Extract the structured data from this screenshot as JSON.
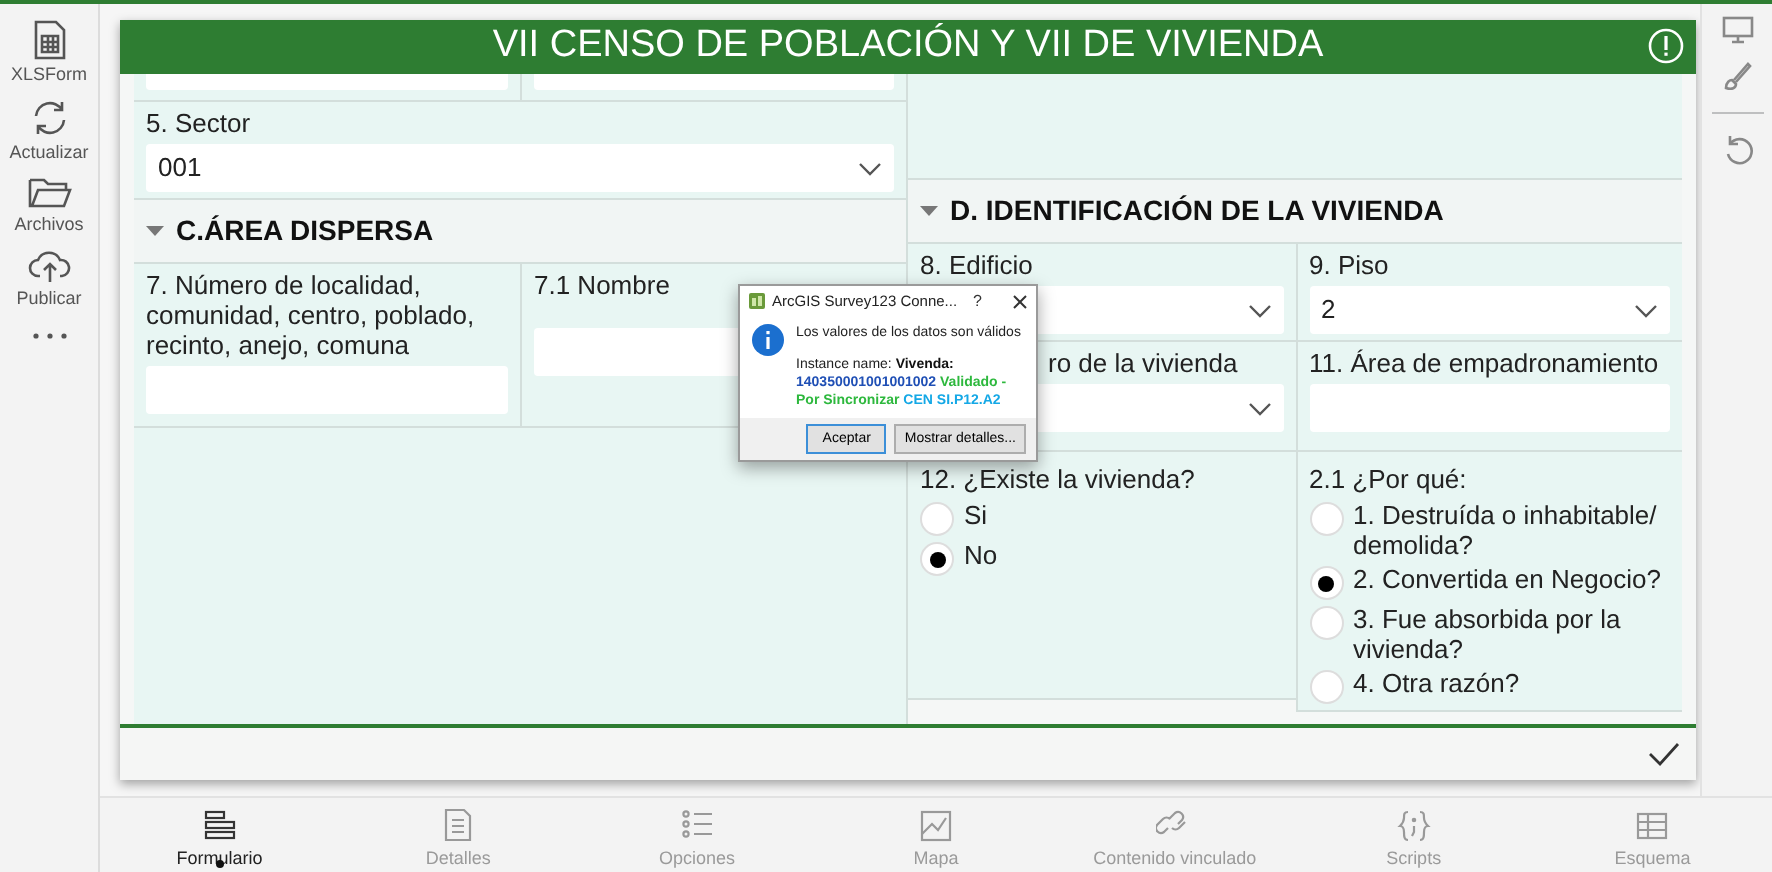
{
  "sidebar": {
    "items": [
      {
        "label": "XLSForm"
      },
      {
        "label": "Actualizar"
      },
      {
        "label": "Archivos"
      },
      {
        "label": "Publicar"
      }
    ]
  },
  "form": {
    "title": "VII CENSO DE POBLACIÓN Y VII DE VIVIENDA",
    "sector": {
      "label": "5. Sector",
      "value": "001"
    },
    "section_c": {
      "title": "C.ÁREA DISPERSA",
      "expanded": true
    },
    "q7": {
      "label": "7. Número de localidad, comunidad, centro, poblado, recinto, anejo, comuna"
    },
    "q7_1": {
      "label": "7.1 Nombre"
    },
    "section_d": {
      "title": "D. IDENTIFICACIÓN DE LA VIVIENDA",
      "expanded": true
    },
    "q8": {
      "label": "8. Edificio"
    },
    "q9": {
      "label": "9. Piso",
      "value": "2"
    },
    "q10": {
      "label": "ro de la vivienda"
    },
    "q11": {
      "label": "11. Área de empadronamiento"
    },
    "q12": {
      "label": "12. ¿Existe la vivienda?",
      "options": [
        {
          "label": "Si",
          "selected": false
        },
        {
          "label": "No",
          "selected": true
        }
      ]
    },
    "q2_1": {
      "label": "2.1 ¿Por qué:",
      "options": [
        {
          "label": "1. Destruída o inhabitable/ demolida?",
          "selected": false
        },
        {
          "label": "2. Convertida en Negocio?",
          "selected": true
        },
        {
          "label": "3. Fue absorbida por la vivienda?",
          "selected": false
        },
        {
          "label": "4. Otra razón?",
          "selected": false
        }
      ]
    }
  },
  "dialog": {
    "title": "ArcGIS Survey123 Conne...",
    "help": "?",
    "message": "Los valores de los datos son válidos",
    "instance": [
      {
        "kind": "plain",
        "text": "Instance name: "
      },
      {
        "kind": "bold",
        "text": "Vivenda:"
      },
      {
        "kind": "id",
        "text": " 140350001001001002"
      },
      {
        "kind": "status",
        "text": " Validado - Por Sincronizar"
      },
      {
        "kind": "code",
        "text": " CEN SI.P12.A2"
      }
    ],
    "buttons": [
      {
        "label": "Aceptar",
        "default": true
      },
      {
        "label": "Mostrar detalles...",
        "default": false
      }
    ]
  },
  "tabs": [
    {
      "label": "Formulario",
      "selected": true
    },
    {
      "label": "Detalles",
      "selected": false
    },
    {
      "label": "Opciones",
      "selected": false
    },
    {
      "label": "Mapa",
      "selected": false
    },
    {
      "label": "Contenido vinculado",
      "selected": false
    },
    {
      "label": "Scripts",
      "selected": false
    },
    {
      "label": "Esquema",
      "selected": false
    }
  ]
}
